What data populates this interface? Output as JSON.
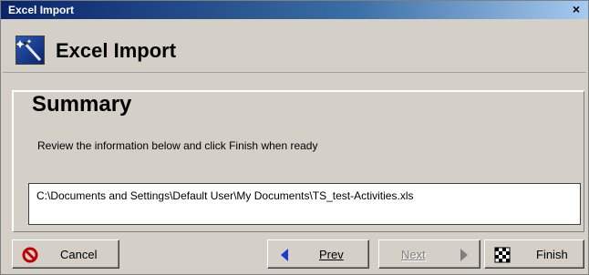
{
  "window": {
    "title": "Excel Import",
    "close_glyph": "×"
  },
  "header": {
    "title": "Excel Import",
    "icon": "wizard-wand-icon"
  },
  "content": {
    "title": "Summary",
    "instructions": "Review the information below and click Finish when ready",
    "file_path": "C:\\Documents and Settings\\Default User\\My Documents\\TS_test-Activities.xls"
  },
  "buttons": {
    "cancel": {
      "label": "Cancel",
      "icon": "no-entry-icon"
    },
    "prev": {
      "label": "Prev",
      "icon": "left-arrow-icon"
    },
    "next": {
      "label": "Next",
      "icon": "right-arrow-icon",
      "enabled": false
    },
    "finish": {
      "label": "Finish",
      "icon": "checkered-flag-icon"
    }
  },
  "colors": {
    "titlebar_start": "#0a246a",
    "titlebar_end": "#a6caf0",
    "dialog_bg": "#d4d0c8",
    "cancel_icon": "#c00000",
    "arrow": "#1a3ccf"
  }
}
